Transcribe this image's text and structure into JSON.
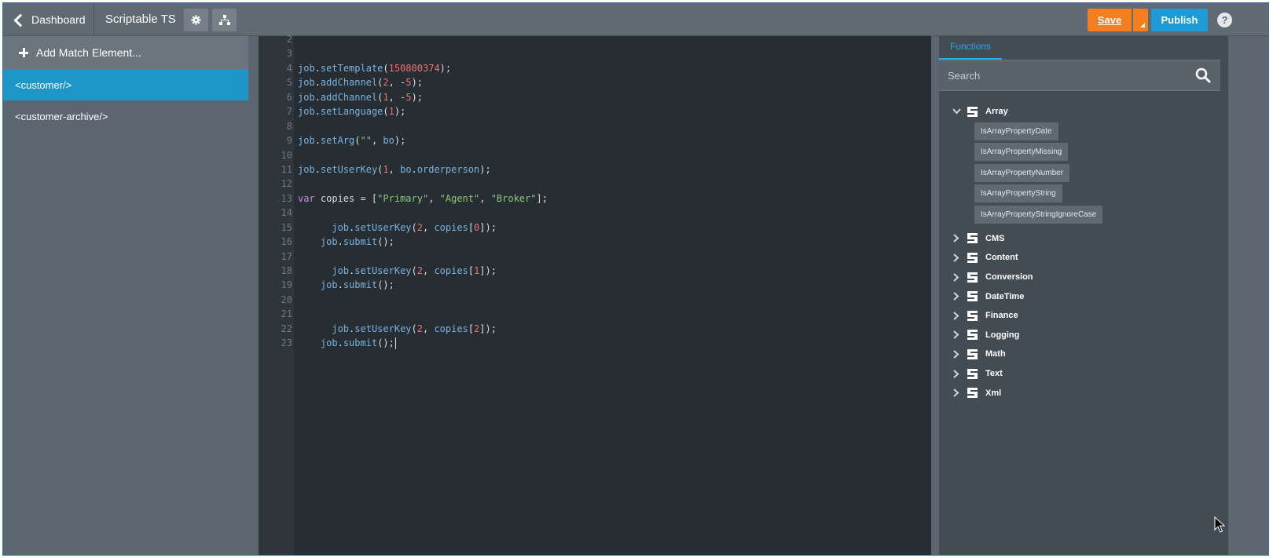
{
  "topbar": {
    "back_label": "Dashboard",
    "app_title": "Scriptable TS",
    "settings_icon": "gear-icon",
    "structure_icon": "sitemap-icon",
    "save_label": "Save",
    "publish_label": "Publish",
    "help_label": "?"
  },
  "leftpanel": {
    "add_label": "Add Match Element...",
    "items": [
      {
        "label": "<customer/>",
        "active": true
      },
      {
        "label": "<customer-archive/>",
        "active": false
      }
    ]
  },
  "editor": {
    "lines": [
      {
        "n": "2",
        "text": ""
      },
      {
        "n": "3",
        "text": ""
      },
      {
        "n": "4",
        "text": "job.setTemplate(150800374);"
      },
      {
        "n": "5",
        "text": "job.addChannel(2, -5);"
      },
      {
        "n": "6",
        "text": "job.addChannel(1, -5);"
      },
      {
        "n": "7",
        "text": "job.setLanguage(1);"
      },
      {
        "n": "8",
        "text": ""
      },
      {
        "n": "9",
        "text": "job.setArg(\"\", bo);"
      },
      {
        "n": "10",
        "text": ""
      },
      {
        "n": "11",
        "text": "job.setUserKey(1, bo.orderperson);"
      },
      {
        "n": "12",
        "text": ""
      },
      {
        "n": "13",
        "text": "var copies = [\"Primary\", \"Agent\", \"Broker\"];"
      },
      {
        "n": "14",
        "text": ""
      },
      {
        "n": "15",
        "text": "      job.setUserKey(2, copies[0]);"
      },
      {
        "n": "16",
        "text": "    job.submit();"
      },
      {
        "n": "17",
        "text": ""
      },
      {
        "n": "18",
        "text": "      job.setUserKey(2, copies[1]);"
      },
      {
        "n": "19",
        "text": "    job.submit();"
      },
      {
        "n": "20",
        "text": ""
      },
      {
        "n": "21",
        "text": ""
      },
      {
        "n": "22",
        "text": "      job.setUserKey(2, copies[2]);"
      },
      {
        "n": "23",
        "text": "    job.submit();"
      }
    ]
  },
  "functions": {
    "tab_label": "Functions",
    "search_placeholder": "Search",
    "categories": [
      {
        "name": "Array",
        "expanded": true,
        "items": [
          "IsArrayPropertyDate",
          "IsArrayPropertyMissing",
          "IsArrayPropertyNumber",
          "IsArrayPropertyString",
          "IsArrayPropertyStringIgnoreCase"
        ]
      },
      {
        "name": "CMS",
        "expanded": false,
        "items": []
      },
      {
        "name": "Content",
        "expanded": false,
        "items": []
      },
      {
        "name": "Conversion",
        "expanded": false,
        "items": []
      },
      {
        "name": "DateTime",
        "expanded": false,
        "items": []
      },
      {
        "name": "Finance",
        "expanded": false,
        "items": []
      },
      {
        "name": "Logging",
        "expanded": false,
        "items": []
      },
      {
        "name": "Math",
        "expanded": false,
        "items": []
      },
      {
        "name": "Text",
        "expanded": false,
        "items": []
      },
      {
        "name": "Xml",
        "expanded": false,
        "items": []
      }
    ]
  },
  "colors": {
    "save": "#f47f20",
    "publish": "#1e9bd7",
    "active_item": "#1e97c8",
    "editor_bg": "#262d33",
    "tab_accent": "#25a7e8"
  }
}
